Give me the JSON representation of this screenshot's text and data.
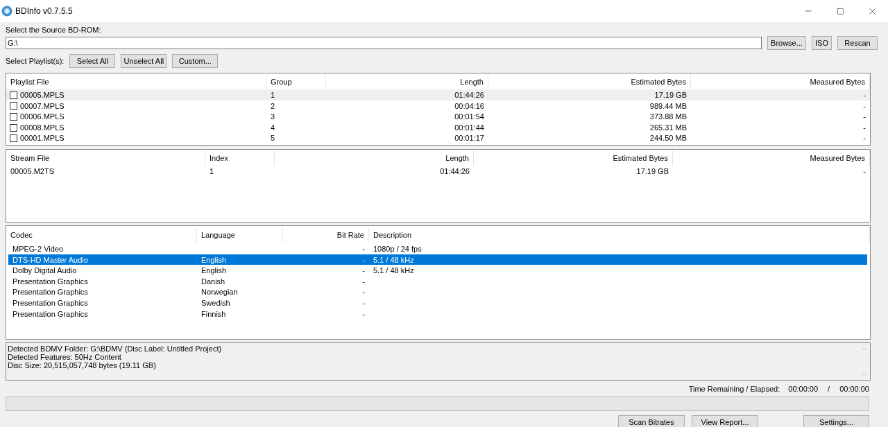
{
  "window": {
    "title": "BDInfo v0.7.5.5"
  },
  "source": {
    "label": "Select the Source BD-ROM:",
    "value": "G:\\",
    "buttons": [
      "Browse...",
      "ISO",
      "Rescan"
    ]
  },
  "playlist_select": {
    "label": "Select Playlist(s):",
    "buttons": [
      "Select All",
      "Unselect All",
      "Custom..."
    ]
  },
  "playlists": {
    "columns": [
      "Playlist File",
      "Group",
      "Length",
      "Estimated Bytes",
      "Measured Bytes"
    ],
    "rows": [
      {
        "file": "00005.MPLS",
        "group": "1",
        "length": "01:44:26",
        "estimated_bytes": "17.19 GB",
        "measured_bytes": "-",
        "checked": false,
        "hovered": true
      },
      {
        "file": "00007.MPLS",
        "group": "2",
        "length": "00:04:16",
        "estimated_bytes": "989.44 MB",
        "measured_bytes": "-",
        "checked": false,
        "hovered": false
      },
      {
        "file": "00006.MPLS",
        "group": "3",
        "length": "00:01:54",
        "estimated_bytes": "373.88 MB",
        "measured_bytes": "-",
        "checked": false,
        "hovered": false
      },
      {
        "file": "00008.MPLS",
        "group": "4",
        "length": "00:01:44",
        "estimated_bytes": "265.31 MB",
        "measured_bytes": "-",
        "checked": false,
        "hovered": false
      },
      {
        "file": "00001.MPLS",
        "group": "5",
        "length": "00:01:17",
        "estimated_bytes": "244.50 MB",
        "measured_bytes": "-",
        "checked": false,
        "hovered": false
      }
    ]
  },
  "streams": {
    "columns": [
      "Stream File",
      "Index",
      "Length",
      "Estimated Bytes",
      "Measured Bytes"
    ],
    "rows": [
      {
        "file": "00005.M2TS",
        "index": "1",
        "length": "01:44:26",
        "estimated_bytes": "17.19 GB",
        "measured_bytes": "-"
      }
    ]
  },
  "codecs": {
    "columns": [
      "Codec",
      "Language",
      "Bit Rate",
      "Description"
    ],
    "rows": [
      {
        "codec": "MPEG-2 Video",
        "bit_rate": "-",
        "description": "1080p / 24 fps",
        "selected": false
      },
      {
        "codec": "DTS-HD Master Audio",
        "language": "English",
        "bit_rate": "-",
        "description": "5.1 / 48 kHz",
        "selected": true
      },
      {
        "codec": "Dolby Digital Audio",
        "language": "English",
        "bit_rate": "-",
        "description": "5.1 / 48 kHz",
        "selected": false
      },
      {
        "codec": "Presentation Graphics",
        "language": "Danish",
        "bit_rate": "-",
        "selected": false
      },
      {
        "codec": "Presentation Graphics",
        "language": "Norwegian",
        "bit_rate": "-",
        "selected": false
      },
      {
        "codec": "Presentation Graphics",
        "language": "Swedish",
        "bit_rate": "-",
        "selected": false
      },
      {
        "codec": "Presentation Graphics",
        "language": "Finnish",
        "bit_rate": "-",
        "selected": false
      }
    ]
  },
  "log": {
    "lines": [
      "Detected BDMV Folder: G:\\BDMV (Disc Label: Untitled Project)",
      "Detected Features: 50Hz Content",
      "Disc Size: 20,515,057,748 bytes (19.11 GB)"
    ]
  },
  "timer": {
    "label": "Time Remaining / Elapsed:",
    "remaining": "00:00:00",
    "separator": "/",
    "elapsed": "00:00:00"
  },
  "progress": {
    "level": 0
  },
  "buttons": [
    "Scan Bitrates",
    "View Report...",
    "Settings..."
  ]
}
